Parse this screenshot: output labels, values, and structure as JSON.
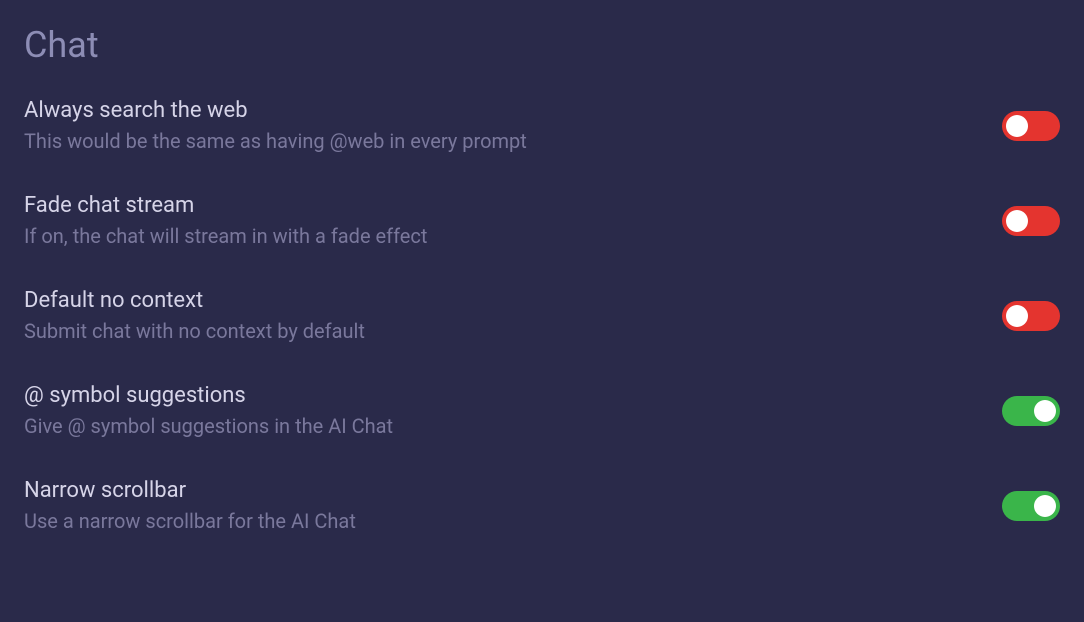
{
  "section": {
    "title": "Chat"
  },
  "settings": [
    {
      "label": "Always search the web",
      "description": "This would be the same as having @web in every prompt",
      "state": "off"
    },
    {
      "label": "Fade chat stream",
      "description": "If on, the chat will stream in with a fade effect",
      "state": "off"
    },
    {
      "label": "Default no context",
      "description": "Submit chat with no context by default",
      "state": "off"
    },
    {
      "label": "@ symbol suggestions",
      "description": "Give @ symbol suggestions in the AI Chat",
      "state": "on"
    },
    {
      "label": "Narrow scrollbar",
      "description": "Use a narrow scrollbar for the AI Chat",
      "state": "on"
    }
  ]
}
